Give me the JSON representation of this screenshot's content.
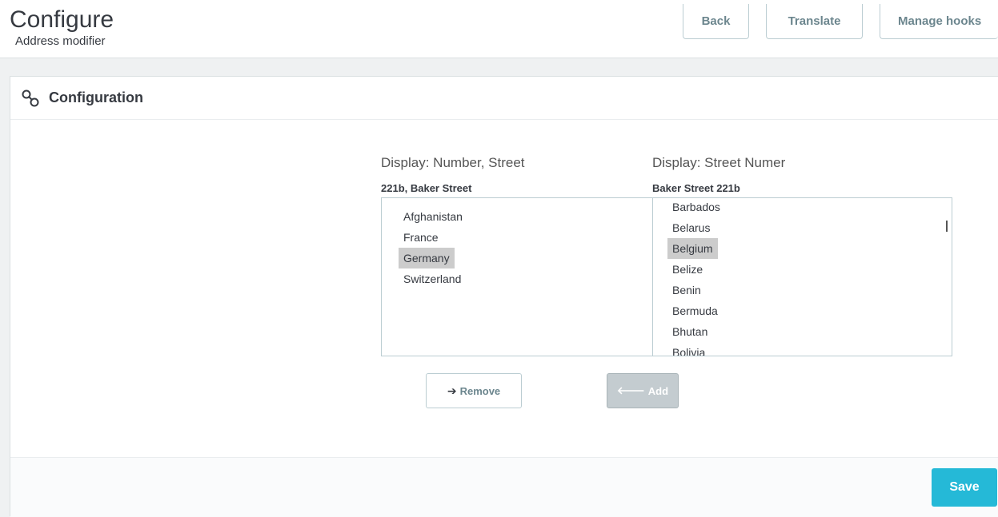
{
  "header": {
    "title": "Configure",
    "subtitle": "Address modifier",
    "toolbar": {
      "back_label": "Back",
      "translate_label": "Translate",
      "hooks_label": "Manage hooks"
    }
  },
  "panel": {
    "title": "Configuration",
    "icon": "link-icon",
    "left_column": {
      "title": "Display: Number, Street",
      "example": "221b, Baker Street",
      "items": [
        "Afghanistan",
        "France",
        "Germany",
        "Switzerland"
      ],
      "selected": "Germany"
    },
    "right_column": {
      "title": "Display: Street Numer",
      "example": "Baker Street 221b",
      "items": [
        "Barbados",
        "Belarus",
        "Belgium",
        "Belize",
        "Benin",
        "Bermuda",
        "Bhutan",
        "Bolivia"
      ],
      "selected": "Belgium"
    },
    "remove_label": "Remove",
    "add_label": "Add",
    "save_label": "Save"
  },
  "colors": {
    "accent": "#25b9d7",
    "selected_bg": "#cccccc"
  }
}
